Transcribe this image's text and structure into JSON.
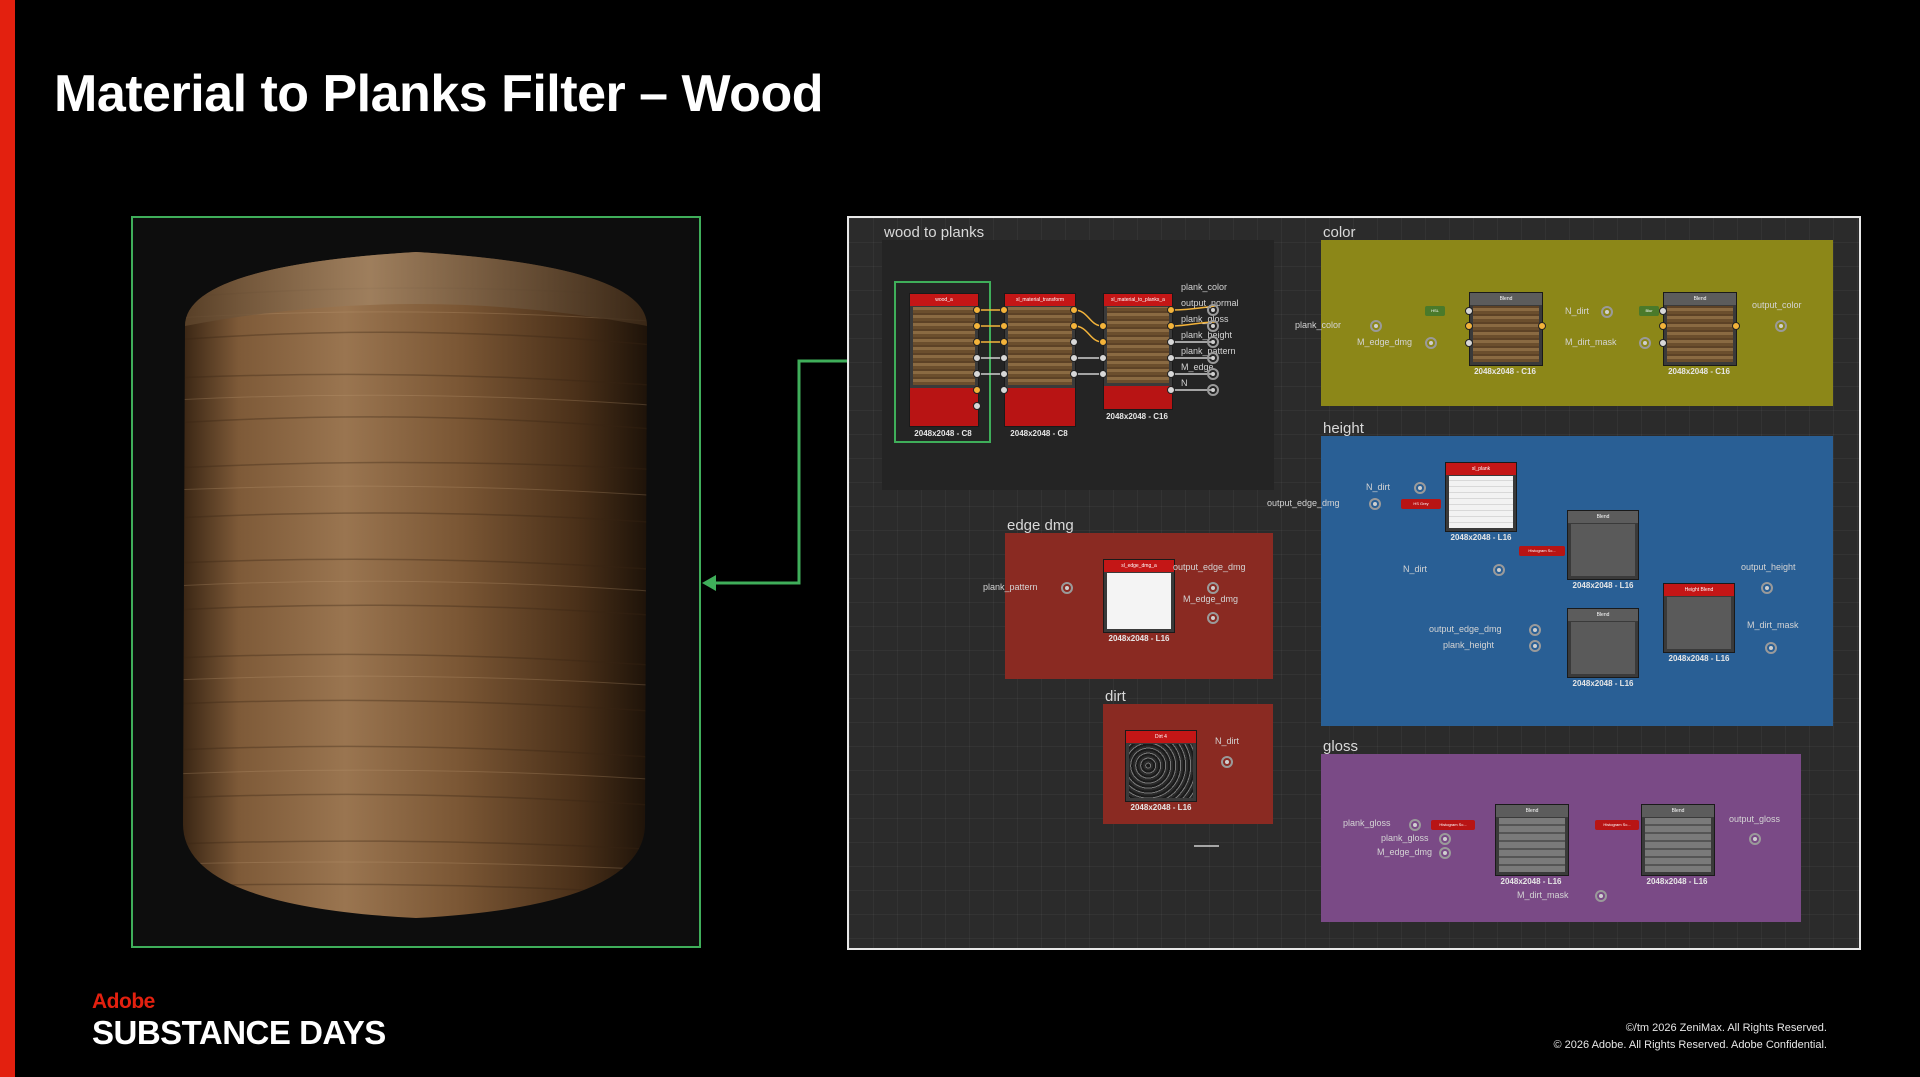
{
  "slide": {
    "title": "Material to Planks Filter – Wood",
    "accent_color": "#e3200f",
    "selection_color": "#3fae5a"
  },
  "preview": {
    "subject": "wood-textured cylinder render"
  },
  "graph": {
    "wood_to_planks": {
      "label": "wood to planks",
      "nodes": [
        {
          "name": "wood_a",
          "size": "2048x2048 - C8"
        },
        {
          "name": "sl_material_transform",
          "size": "2048x2048 - C8"
        },
        {
          "name": "sl_material_to_planks_a",
          "size": "2048x2048 - C16"
        }
      ],
      "outputs": [
        "plank_color",
        "output_normal",
        "plank_gloss",
        "plank_height",
        "plank_pattern",
        "M_edge",
        "N"
      ]
    },
    "color": {
      "label": "color",
      "in1": "plank_color",
      "in2": "M_edge_dmg",
      "mid1": "N_dirt",
      "mid2": "M_dirt_mask",
      "out": "output_color",
      "node1": {
        "name": "Blend",
        "size": "2048x2048 - C16"
      },
      "node2": {
        "name": "Blend",
        "size": "2048x2048 - C16"
      },
      "chip1": "HSL",
      "chip2": "Blur"
    },
    "height": {
      "label": "height",
      "in1": "N_dirt",
      "in2": "output_edge_dmg",
      "in3": "N_dirt",
      "in4": "output_edge_dmg",
      "in5": "plank_height",
      "out1": "output_height",
      "out2": "M_dirt_mask",
      "n1": {
        "name": "sl_plank",
        "size": "2048x2048 - L16"
      },
      "n2": {
        "name": "Blend",
        "size": "2048x2048 - L16"
      },
      "n3": {
        "name": "Blend",
        "size": "2048x2048 - L16"
      },
      "n4": {
        "name": "Height Blend",
        "size": "2048x2048 - L16"
      },
      "chip1": "HS Grey",
      "chip2": "Histogram Sc..."
    },
    "edge_dmg": {
      "label": "edge dmg",
      "in": "plank_pattern",
      "out1": "output_edge_dmg",
      "out2": "M_edge_dmg",
      "node": {
        "name": "sl_edge_dmg_a",
        "size": "2048x2048 - L16"
      }
    },
    "dirt": {
      "label": "dirt",
      "out": "N_dirt",
      "node": {
        "name": "Dirt 4",
        "size": "2048x2048 - L16"
      }
    },
    "gloss": {
      "label": "gloss",
      "in1": "plank_gloss",
      "in2": "plank_gloss",
      "in3": "M_edge_dmg",
      "in4": "M_dirt_mask",
      "out": "output_gloss",
      "n1": {
        "name": "Blend",
        "size": "2048x2048 - L16"
      },
      "n2": {
        "name": "Blend",
        "size": "2048x2048 - L16"
      },
      "chip1": "Histogram Sc...",
      "chip2": "Histogram Sc..."
    }
  },
  "footer": {
    "brand_top": "Adobe",
    "brand_main": "SUBSTANCE DAYS",
    "legal1": "©/tm 2026 ZeniMax. All Rights Reserved.",
    "legal2": "© 2026 Adobe. All Rights Reserved. Adobe Confidential."
  }
}
